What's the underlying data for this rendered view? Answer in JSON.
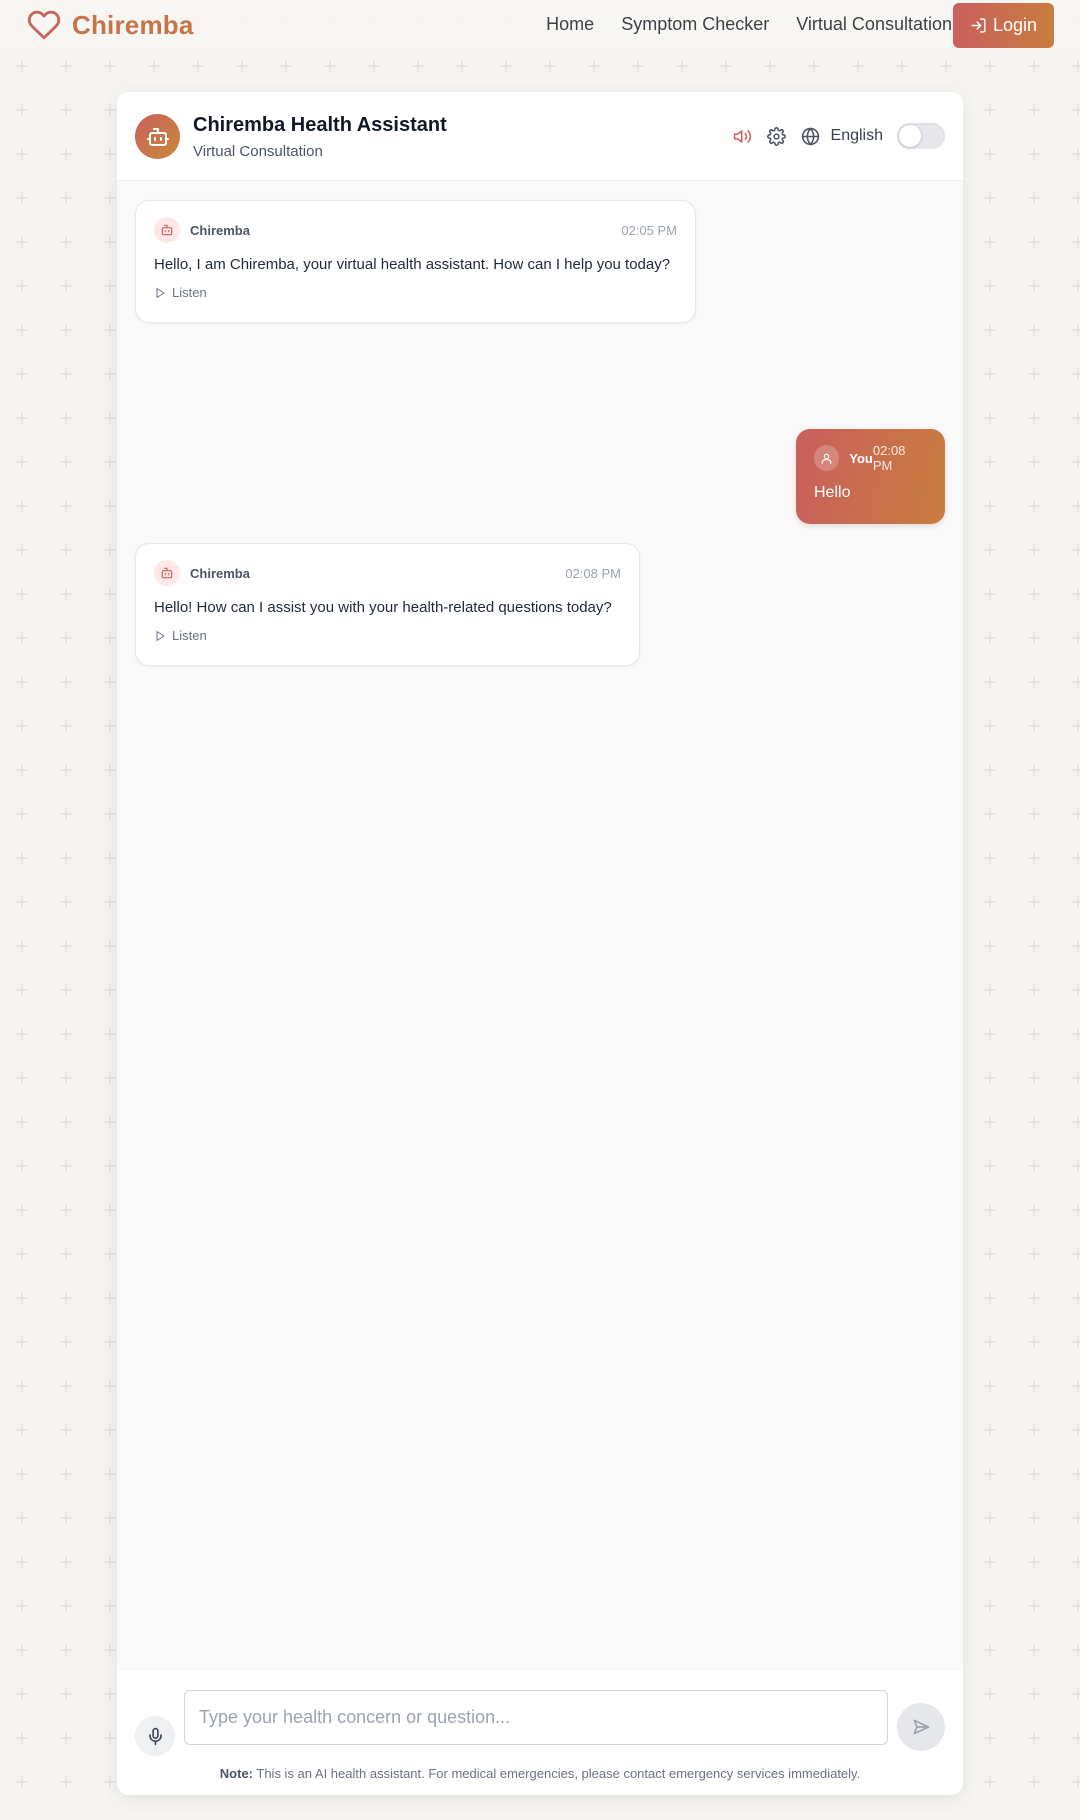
{
  "nav": {
    "brand": "Chiremba",
    "links": [
      "Home",
      "Symptom Checker",
      "Virtual Consultation"
    ],
    "login_label": "Login"
  },
  "chat": {
    "title": "Chiremba Health Assistant",
    "subtitle": "Virtual Consultation",
    "language": "English",
    "messages": [
      {
        "sender": "Chiremba",
        "time": "02:05 PM",
        "text": "Hello, I am Chiremba, your virtual health assistant. How can I help you today?",
        "listen": "Listen"
      },
      {
        "sender": "You",
        "time": "02:08 PM",
        "text": "Hello"
      },
      {
        "sender": "Chiremba",
        "time": "02:08 PM",
        "text": "Hello! How can I assist you with your health-related questions today?",
        "listen": "Listen"
      }
    ],
    "input_placeholder": "Type your health concern or question...",
    "note_label": "Note:",
    "note_text": "This is an AI health assistant. For medical emergencies, please contact emergency services immediately."
  },
  "colors": {
    "brand": "#c8744a",
    "gradient_start": "#c95f5e",
    "gradient_end": "#c97d3e",
    "page_bg": "#f6f4f1"
  },
  "icons": [
    "heart-icon",
    "login-icon",
    "bot-icon",
    "speaker-icon",
    "gear-icon",
    "globe-icon",
    "play-icon",
    "user-icon",
    "mic-icon",
    "send-icon"
  ]
}
